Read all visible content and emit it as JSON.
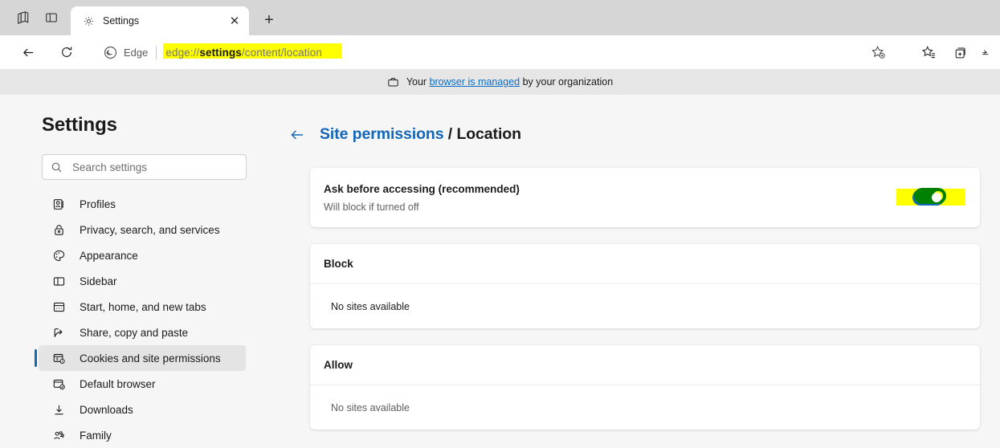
{
  "window": {
    "tabstrip_icons": [
      "tab-stack-icon",
      "vertical-tabs-icon"
    ],
    "tab": {
      "favicon": "gear-icon",
      "title": "Settings",
      "close": "✕"
    },
    "new_tab_label": "+"
  },
  "toolbar": {
    "back_icon": "back-arrow-icon",
    "reload_icon": "reload-icon",
    "edge_label": "Edge",
    "url_prefix": "edge://",
    "url_bold": "settings",
    "url_suffix": "/content/location",
    "url_full": "edge://settings/content/location",
    "favorite_icon": "add-favorite-star-icon",
    "favorites_icon": "favorites-list-icon",
    "collections_icon": "collections-icon",
    "highlight_color": "#ffff00"
  },
  "managed_banner": {
    "icon": "briefcase-icon",
    "prefix": "Your ",
    "link": "browser is managed",
    "suffix": " by your organization",
    "link_color": "#0d6dc4"
  },
  "sidebar": {
    "title": "Settings",
    "search": {
      "placeholder": "Search settings",
      "value": "",
      "icon": "search-icon"
    },
    "items": [
      {
        "label": "Profiles",
        "icon": "profile-icon",
        "active": false
      },
      {
        "label": "Privacy, search, and services",
        "icon": "lock-icon",
        "active": false
      },
      {
        "label": "Appearance",
        "icon": "palette-icon",
        "active": false
      },
      {
        "label": "Sidebar",
        "icon": "sidebar-icon",
        "active": false
      },
      {
        "label": "Start, home, and new tabs",
        "icon": "home-tabs-icon",
        "active": false
      },
      {
        "label": "Share, copy and paste",
        "icon": "share-icon",
        "active": false
      },
      {
        "label": "Cookies and site permissions",
        "icon": "cookies-permissions-icon",
        "active": true
      },
      {
        "label": "Default browser",
        "icon": "default-browser-icon",
        "active": false
      },
      {
        "label": "Downloads",
        "icon": "download-icon",
        "active": false
      },
      {
        "label": "Family",
        "icon": "family-icon",
        "active": false
      }
    ],
    "accent_color": "#0f6cbd"
  },
  "main": {
    "breadcrumb": {
      "back_icon": "back-arrow-icon",
      "parent": "Site permissions",
      "separator": " / ",
      "current": "Location",
      "parent_color": "#1366b8"
    },
    "ask_card": {
      "title": "Ask before accessing (recommended)",
      "subtitle": "Will block if turned off",
      "toggle_state": "on",
      "toggle_color": "#0f6cbd",
      "highlight_color": "#ffff00"
    },
    "block_card": {
      "heading": "Block",
      "empty_text": "No sites available",
      "highlighted": true
    },
    "allow_card": {
      "heading": "Allow",
      "empty_text": "No sites available",
      "highlighted": false
    }
  }
}
